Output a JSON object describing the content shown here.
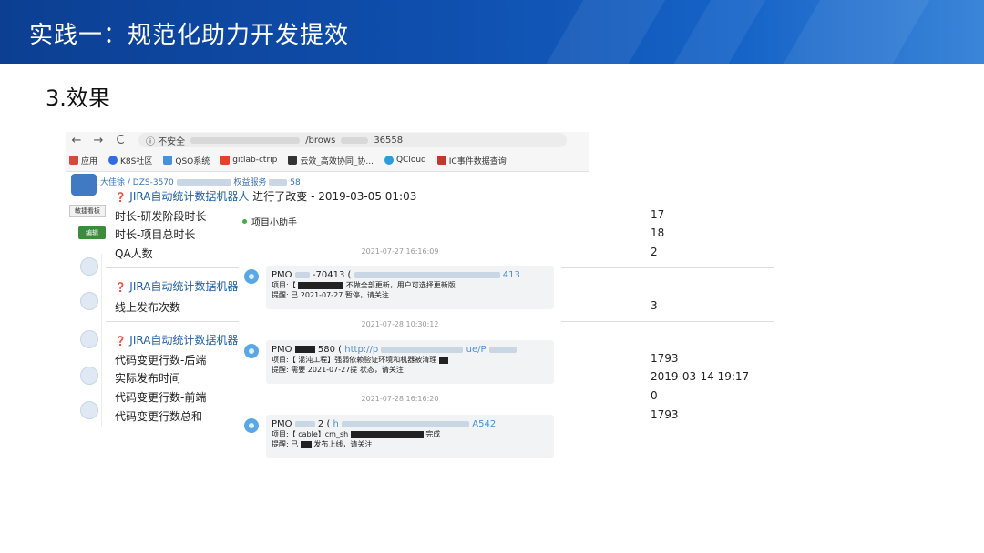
{
  "slide": {
    "title": "实践一：规范化助力开发提效",
    "section": "3.效果"
  },
  "browser": {
    "back": "←",
    "forward": "→",
    "reload": "C",
    "info": "ⓘ",
    "security_label": "不安全",
    "url_tail": "/brows",
    "url_id": "36558",
    "bookmarks": [
      {
        "label": "应用",
        "icon": "apps-grid-icon",
        "color": "#d24b3a"
      },
      {
        "label": "K8S社区",
        "icon": "k8s-icon",
        "color": "#326ce5"
      },
      {
        "label": "QSO系统",
        "icon": "qso-icon",
        "color": "#4a90d9"
      },
      {
        "label": "gitlab-ctrip",
        "icon": "gitlab-icon",
        "color": "#e2432a"
      },
      {
        "label": "云效_高效协同_协...",
        "icon": "yunxiao-icon",
        "color": "#333333"
      },
      {
        "label": "QCloud",
        "icon": "qcloud-icon",
        "color": "#2a9de0"
      },
      {
        "label": "IC事件数据查询",
        "icon": "ic-icon",
        "color": "#c0392b"
      }
    ]
  },
  "jira": {
    "breadcrumb_user": "大佳徐",
    "breadcrumb_issue": "DZS-3570",
    "breadcrumb_mid": "权益服务",
    "breadcrumb_tail": "58",
    "side_button": "敏捷看板",
    "edit_button": "编辑",
    "entries": [
      {
        "author": "JIRA自动统计数据机器人",
        "action": "进行了改变 - 2019-03-05 01:03",
        "fields": [
          {
            "label": "时长-研发阶段时长",
            "value": "17"
          },
          {
            "label": "时长-项目总时长",
            "value": "18"
          },
          {
            "label": "QA人数",
            "value": "2"
          }
        ]
      },
      {
        "author": "JIRA自动统计数据机器人",
        "action": "",
        "fields": [
          {
            "label": "线上发布次数",
            "value": "3"
          }
        ]
      },
      {
        "author": "JIRA自动统计数据机器人",
        "action": "",
        "fields": [
          {
            "label": "代码变更行数-后端",
            "value": "1793"
          },
          {
            "label": "实际发布时间",
            "value": "2019-03-14 19:17"
          },
          {
            "label": "代码变更行数-前端",
            "value": "0"
          },
          {
            "label": "代码变更行数总和",
            "value": "1793"
          }
        ]
      }
    ]
  },
  "chat": {
    "title": "项目小助手",
    "messages": [
      {
        "timestamp": "2021-07-27 16:16:09",
        "sender": "PMO",
        "sender_id": "-70413",
        "link_tail": "413",
        "project_prefix": "项目:【",
        "project_text": "不做全部更新，用户可选择更新版",
        "remind_prefix": "提醒: 已",
        "remind_text": "2021-07-27 暂停，请关注"
      },
      {
        "timestamp": "2021-07-28 10:30:12",
        "sender": "PMO",
        "sender_id": "580",
        "link_head": "http://p",
        "link_mid": "ue/P",
        "project_prefix": "项目:【",
        "project_text": "混沌工程】强弱依赖验证环境和机器被清理",
        "remind_prefix": "提醒: 需要",
        "remind_text": "2021-07-27提    状态，请关注"
      },
      {
        "timestamp": "2021-07-28 16:16:20",
        "sender": "PMO",
        "sender_id": "2",
        "link_head": "h",
        "link_tail": "A542",
        "project_prefix": "项目:【",
        "project_text": "cable】cm_sh",
        "project_suffix": "完成",
        "remind_prefix": "提醒: 已",
        "remind_text": "发布上线，请关注"
      }
    ]
  }
}
